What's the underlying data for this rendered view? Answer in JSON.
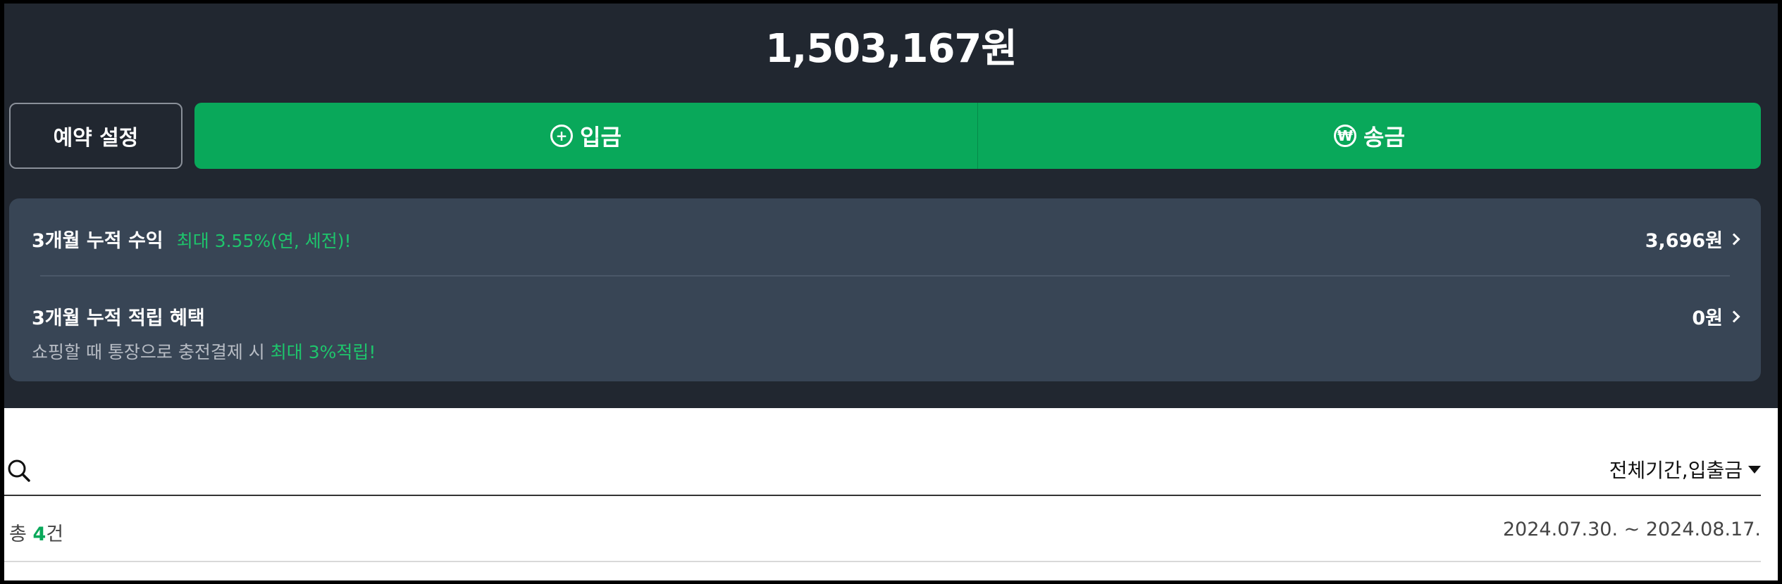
{
  "header": {
    "balance": "1,503,167원"
  },
  "actions": {
    "reserve_label": "예약 설정",
    "deposit_label": "입금",
    "transfer_label": "송금",
    "deposit_icon": "plus-circle-icon",
    "transfer_icon": "won-circle-icon"
  },
  "summary": {
    "interest": {
      "title": "3개월 누적 수익",
      "highlight": "최대 3.55%(연, 세전)!",
      "value": "3,696원"
    },
    "rewards": {
      "title": "3개월 누적 적립 혜택",
      "value": "0원",
      "sub_text": "쇼핑할 때 통장으로 충전결제 시 ",
      "sub_highlight": "최대 3%적립!"
    }
  },
  "list": {
    "filter_label": "전체기간,입출금",
    "count_prefix": "총 ",
    "count_value": "4",
    "count_suffix": "건",
    "period": "2024.07.30. ~ 2024.08.17."
  },
  "colors": {
    "dark_bg": "#212730",
    "card_bg": "#384555",
    "accent_green": "#09a85a",
    "highlight_green": "#1ec56c"
  }
}
